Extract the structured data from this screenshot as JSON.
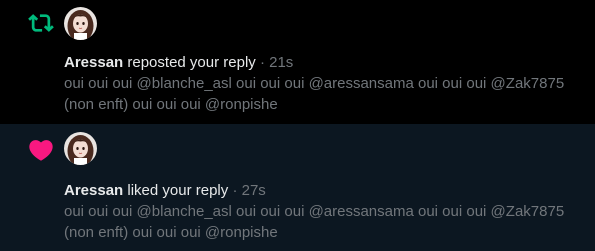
{
  "colors": {
    "background": "#000000",
    "highlighted_background": "#0c1721",
    "repost_green": "#00ba7c",
    "like_pink": "#f91880",
    "primary_text": "#e7e9ea",
    "secondary_text": "#71767b"
  },
  "notifications": [
    {
      "type": "repost",
      "icon": "repost-icon",
      "user_name": "Aressan",
      "action_text": "reposted your reply",
      "separator": "·",
      "timestamp": "21s",
      "body_text": "oui oui oui @blanche_asl oui oui oui @aressansama oui oui oui @Zak7875 (non enft) oui oui oui @ronpishe"
    },
    {
      "type": "like",
      "icon": "heart-icon",
      "user_name": "Aressan",
      "action_text": "liked your reply",
      "separator": "·",
      "timestamp": "27s",
      "body_text": "oui oui oui @blanche_asl oui oui oui @aressansama oui oui oui @Zak7875 (non enft) oui oui oui @ronpishe"
    }
  ]
}
